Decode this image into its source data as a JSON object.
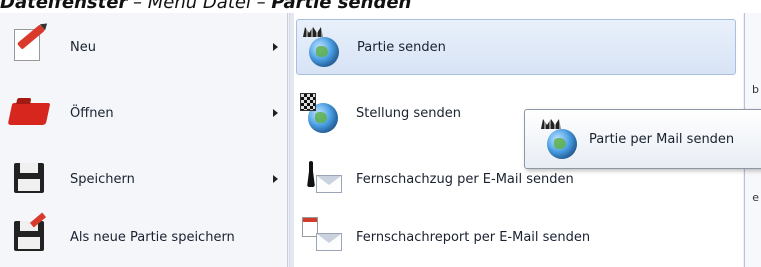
{
  "heading": {
    "part1": "Dateifenster",
    "sep1": " – ",
    "part2": "Menü Datei",
    "sep2": " – ",
    "part3": "Partie senden"
  },
  "left_menu": {
    "items": [
      {
        "label": "Neu",
        "icon": "pencil-icon"
      },
      {
        "label": "Öffnen",
        "icon": "folder-icon"
      },
      {
        "label": "Speichern",
        "icon": "floppy-icon"
      },
      {
        "label": "Als neue Partie speichern",
        "icon": "save-as-icon"
      }
    ]
  },
  "submenu": {
    "items": [
      {
        "label": "Partie senden",
        "icon": "globe-chess-icon"
      },
      {
        "label": "Stellung senden",
        "icon": "globe-board-icon"
      },
      {
        "label": "Fernschachzug per E-Mail senden",
        "icon": "pawn-mail-icon"
      },
      {
        "label": "Fernschachreport per E-Mail senden",
        "icon": "report-mail-icon"
      }
    ]
  },
  "tooltip": {
    "label": "Partie per Mail senden",
    "icon": "globe-chess-icon"
  },
  "right_edge": {
    "frag1": "b",
    "frag2": "e"
  }
}
